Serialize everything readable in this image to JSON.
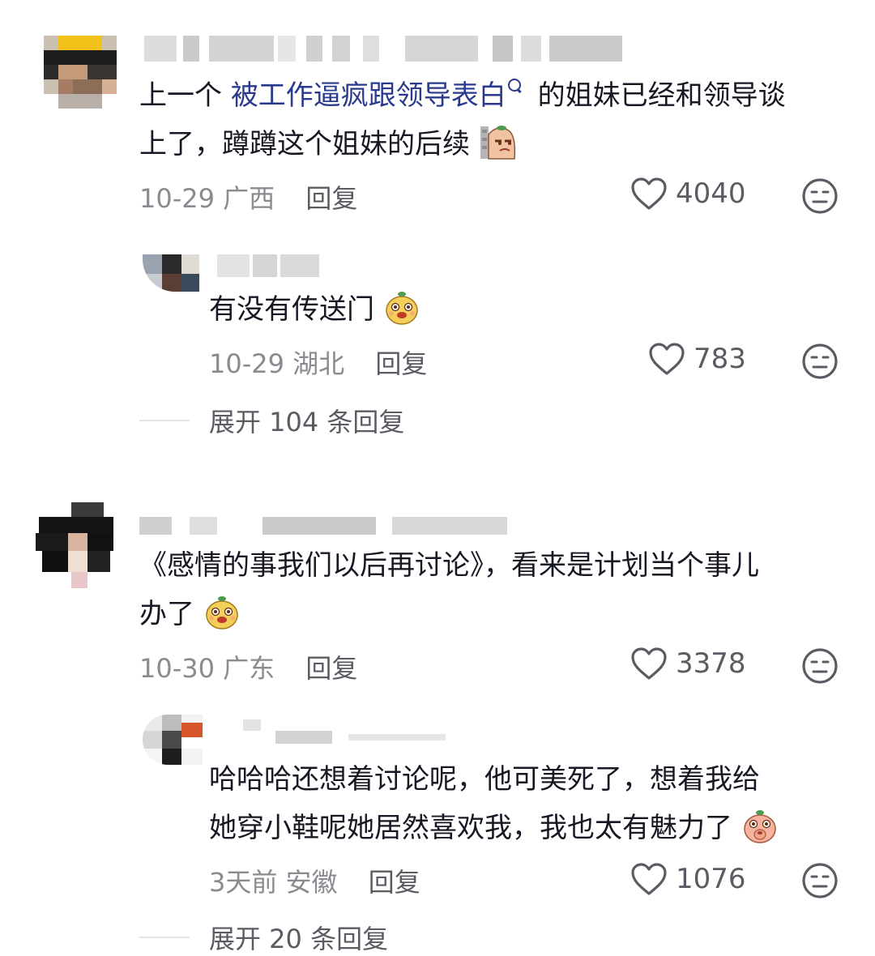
{
  "comments": [
    {
      "text_line1_pre": "上一个 ",
      "text_line1_link": "被工作逼疯跟领导表白",
      "text_line1_post": " 的姐妹已经和领导谈",
      "text_line2": "上了，蹲蹲这个姐妹的后续",
      "emoji": "dog-side-eye-emoji",
      "date": "10-29",
      "location": "广西",
      "reply_label": "回复",
      "likes": "4040"
    },
    {
      "text_line1": "有没有传送门",
      "emoji": "yellow-mascot-emoji",
      "date": "10-29",
      "location": "湖北",
      "reply_label": "回复",
      "likes": "783"
    },
    {
      "text_line1": "《感情的事我们以后再讨论》，看来是计划当个事儿",
      "text_line2": "办了",
      "emoji": "yellow-mascot-emoji",
      "date": "10-30",
      "location": "广东",
      "reply_label": "回复",
      "likes": "3378"
    },
    {
      "text_line1": "哈哈哈还想着讨论呢，他可美死了，想着我给",
      "text_line2": "她穿小鞋呢她居然喜欢我，我也太有魅力了",
      "emoji": "pink-mascot-emoji",
      "date": "3天前",
      "location": "安徽",
      "reply_label": "回复",
      "likes": "1076"
    }
  ],
  "expand_replies": [
    {
      "label": "展开 104 条回复"
    },
    {
      "label": "展开 20 条回复"
    }
  ],
  "colors": {
    "text": "#161823",
    "meta": "#8a8b91",
    "link": "#2a3a8c",
    "icon": "#5b5c63"
  }
}
